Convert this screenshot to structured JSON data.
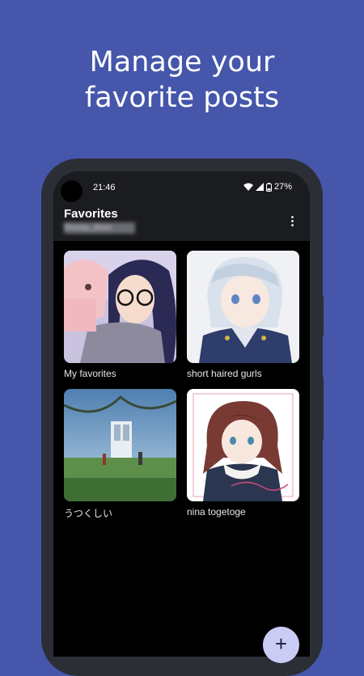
{
  "headline": {
    "line1": "Manage your",
    "line2": "favorite posts"
  },
  "status_bar": {
    "time": "21:46",
    "battery": "27%"
  },
  "app_bar": {
    "title": "Favorites",
    "subtitle": "Mousa_Jinxx",
    "menu_icon": "more-vertical-icon"
  },
  "favorites": [
    {
      "label": "My favorites"
    },
    {
      "label": "short haired gurls"
    },
    {
      "label": "うつくしい"
    },
    {
      "label": "nina togetoge"
    }
  ],
  "fab": {
    "icon": "plus-icon",
    "label": "+"
  },
  "colors": {
    "background": "#4556ab",
    "app_bar": "#1b1c20",
    "fab": "#c9ccf5"
  }
}
